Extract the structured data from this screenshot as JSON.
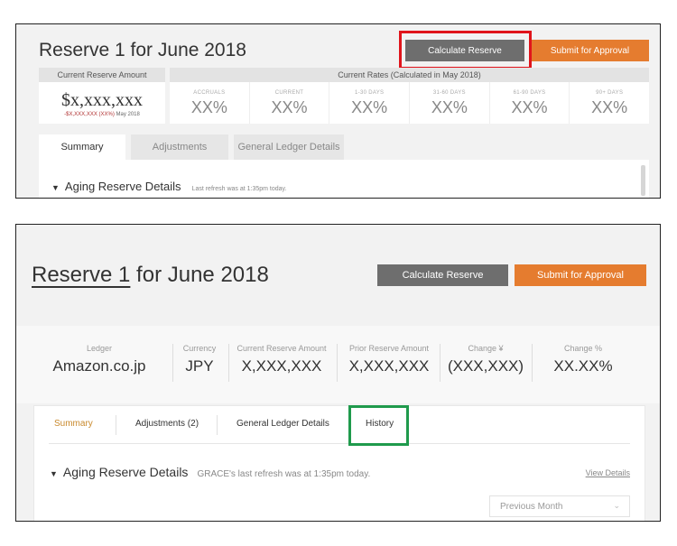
{
  "panel1": {
    "title": "Reserve 1 for June 2018",
    "calculate_label": "Calculate Reserve",
    "submit_label": "Submit for Approval",
    "current_reserve_header": "Current Reserve Amount",
    "current_reserve_value": "$x,xxx,xxx",
    "current_reserve_sub": "-$X,XXX,XXX (XX%)",
    "current_reserve_sub_date": "May 2018",
    "rates_header": "Current Rates (Calculated in May 2018)",
    "rates": [
      {
        "label": "ACCRUALS",
        "value": "XX%"
      },
      {
        "label": "CURRENT",
        "value": "XX%"
      },
      {
        "label": "1-30 DAYS",
        "value": "XX%"
      },
      {
        "label": "31-60 DAYS",
        "value": "XX%"
      },
      {
        "label": "61-90 DAYS",
        "value": "XX%"
      },
      {
        "label": "90+ DAYS",
        "value": "XX%"
      }
    ],
    "tabs": [
      "Summary",
      "Adjustments",
      "General Ledger Details"
    ],
    "aging_title": "Aging Reserve Details",
    "refresh_text": "Last refresh was at 1:35pm today."
  },
  "panel2": {
    "title_link": "Reserve 1",
    "title_rest": " for June 2018",
    "calculate_label": "Calculate Reserve",
    "submit_label": "Submit for Approval",
    "stats": [
      {
        "label": "Ledger",
        "value": "Amazon.co.jp"
      },
      {
        "label": "Currency",
        "value": "JPY"
      },
      {
        "label": "Current Reserve Amount",
        "value": "X,XXX,XXX"
      },
      {
        "label": "Prior Reserve Amount",
        "value": "X,XXX,XXX"
      },
      {
        "label": "Change ¥",
        "value": "(XXX,XXX)"
      },
      {
        "label": "Change %",
        "value": "XX.XX%"
      }
    ],
    "tabs": [
      "Summary",
      "Adjustments (2)",
      "General Ledger Details",
      "History"
    ],
    "aging_title": "Aging Reserve Details",
    "refresh_text": "GRACE's last refresh was at 1:35pm today.",
    "view_details": "View Details",
    "select_value": "Previous Month"
  },
  "colors": {
    "accent_orange": "#e57c2f",
    "button_gray": "#6e6e6e",
    "highlight_red": "#e0141b",
    "highlight_green": "#1f9a4c",
    "active_tab": "#c98a2e"
  }
}
